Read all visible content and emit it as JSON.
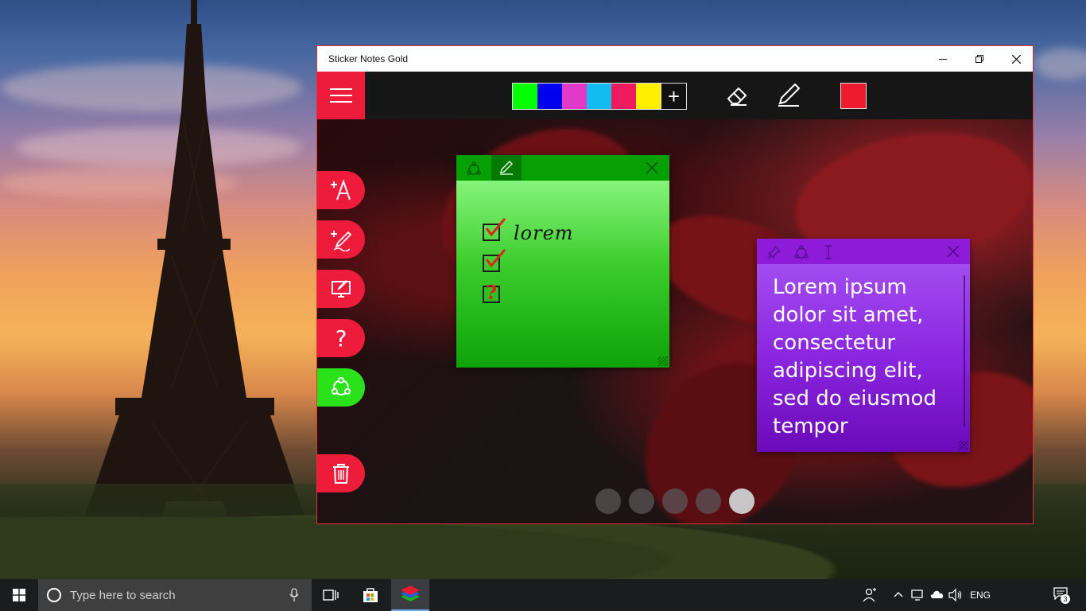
{
  "window": {
    "title": "Sticker Notes Gold",
    "minimize_icon": "minimize-icon",
    "restore_icon": "restore-icon",
    "close_icon": "close-icon"
  },
  "toolbar": {
    "menu_icon": "hamburger-menu-icon",
    "swatches": [
      "#00ff00",
      "#0000ee",
      "#e13ac8",
      "#11bdf0",
      "#ee1b5e",
      "#ffee00"
    ],
    "add_swatch_label": "+",
    "eraser_icon": "eraser-icon",
    "pen_icon": "pen-icon",
    "current_pen_color": "#ee1b2e"
  },
  "sidebar": {
    "buttons": [
      {
        "name": "add-text-note-button",
        "icon": "add-text-icon",
        "color": "#ee1b3a"
      },
      {
        "name": "add-drawing-note-button",
        "icon": "add-drawing-icon",
        "color": "#ee1b3a"
      },
      {
        "name": "edit-background-button",
        "icon": "edit-screen-icon",
        "color": "#ee1b3a"
      },
      {
        "name": "help-button",
        "icon": "question-icon",
        "color": "#ee1b3a"
      },
      {
        "name": "share-button",
        "icon": "share-icon",
        "color": "#2ae21a"
      },
      {
        "name": "delete-button",
        "icon": "trash-icon",
        "color": "#ee1b3a"
      }
    ],
    "help_glyph": "?"
  },
  "notes": {
    "green": {
      "color": "#06a004",
      "handwriting": "lorem",
      "checklist": [
        "checked",
        "checked",
        "question"
      ]
    },
    "purple": {
      "color": "#8d1bd8",
      "text": "Lorem ipsum dolor sit amet, consectetur adipiscing elit, sed do eiusmod tempor"
    }
  },
  "pager": {
    "count": 5,
    "active_index": 4
  },
  "taskbar": {
    "search_placeholder": "Type here to search",
    "language": "ENG",
    "notification_count": "3"
  }
}
